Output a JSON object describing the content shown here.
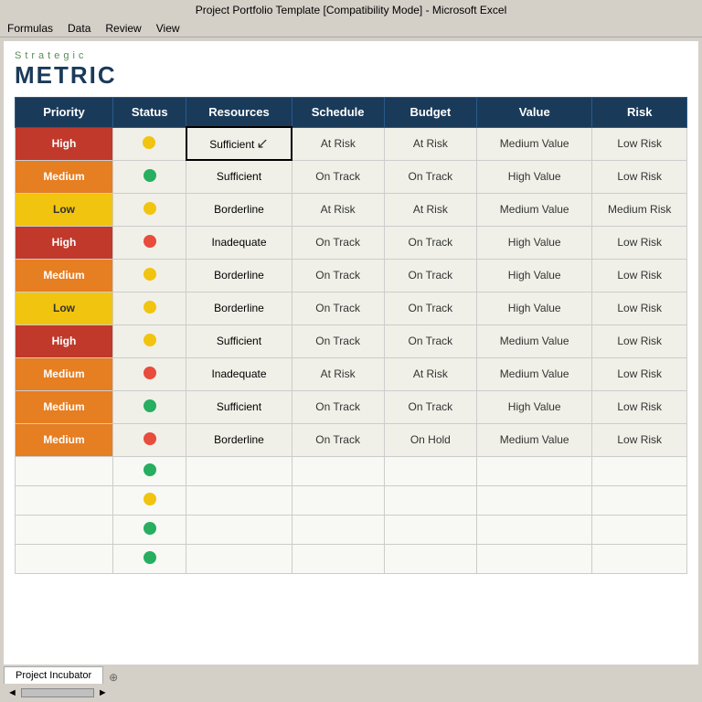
{
  "title_bar": {
    "text": "Project Portfolio Template [Compatibility Mode] - Microsoft Excel"
  },
  "menu": {
    "items": [
      "Formulas",
      "Data",
      "Review",
      "View"
    ]
  },
  "logo": {
    "strategic": "Strategic",
    "metric": "METRIC"
  },
  "table": {
    "headers": [
      "Priority",
      "Status",
      "Resources",
      "Schedule",
      "Budget",
      "Value",
      "Risk"
    ],
    "rows": [
      {
        "priority": "High",
        "priority_class": "priority-high",
        "status_dot": "dot-yellow",
        "resources": "Sufficient",
        "schedule": "At Risk",
        "budget": "At Risk",
        "value": "Medium Value",
        "risk": "Low Risk",
        "selected_resources": true
      },
      {
        "priority": "Medium",
        "priority_class": "priority-medium",
        "status_dot": "dot-green",
        "resources": "Sufficient",
        "schedule": "On Track",
        "budget": "On Track",
        "value": "High Value",
        "risk": "Low Risk"
      },
      {
        "priority": "Low",
        "priority_class": "priority-low",
        "status_dot": "dot-yellow",
        "resources": "Borderline",
        "schedule": "At Risk",
        "budget": "At Risk",
        "value": "Medium Value",
        "risk": "Medium Risk"
      },
      {
        "priority": "High",
        "priority_class": "priority-high",
        "status_dot": "dot-red",
        "resources": "Inadequate",
        "schedule": "On Track",
        "budget": "On Track",
        "value": "High Value",
        "risk": "Low Risk"
      },
      {
        "priority": "Medium",
        "priority_class": "priority-medium",
        "status_dot": "dot-yellow",
        "resources": "Borderline",
        "schedule": "On Track",
        "budget": "On Track",
        "value": "High Value",
        "risk": "Low Risk"
      },
      {
        "priority": "Low",
        "priority_class": "priority-low",
        "status_dot": "dot-yellow",
        "resources": "Borderline",
        "schedule": "On Track",
        "budget": "On Track",
        "value": "High Value",
        "risk": "Low Risk"
      },
      {
        "priority": "High",
        "priority_class": "priority-high",
        "status_dot": "dot-yellow",
        "resources": "Sufficient",
        "schedule": "On Track",
        "budget": "On Track",
        "value": "Medium Value",
        "risk": "Low Risk"
      },
      {
        "priority": "Medium",
        "priority_class": "priority-medium",
        "status_dot": "dot-red",
        "resources": "Inadequate",
        "schedule": "At Risk",
        "budget": "At Risk",
        "value": "Medium Value",
        "risk": "Low Risk"
      },
      {
        "priority": "Medium",
        "priority_class": "priority-medium",
        "status_dot": "dot-green",
        "resources": "Sufficient",
        "schedule": "On Track",
        "budget": "On Track",
        "value": "High Value",
        "risk": "Low Risk"
      },
      {
        "priority": "Medium",
        "priority_class": "priority-medium",
        "status_dot": "dot-red",
        "resources": "Borderline",
        "schedule": "On Track",
        "budget": "On Hold",
        "value": "Medium Value",
        "risk": "Low Risk"
      }
    ],
    "empty_rows": [
      {
        "dot": "dot-green"
      },
      {
        "dot": "dot-yellow"
      },
      {
        "dot": "dot-green"
      },
      {
        "dot": "dot-green"
      }
    ]
  },
  "tab": {
    "label": "Project Incubator"
  },
  "bottom": {
    "scroll_left": "◄",
    "scroll_right": "►"
  }
}
